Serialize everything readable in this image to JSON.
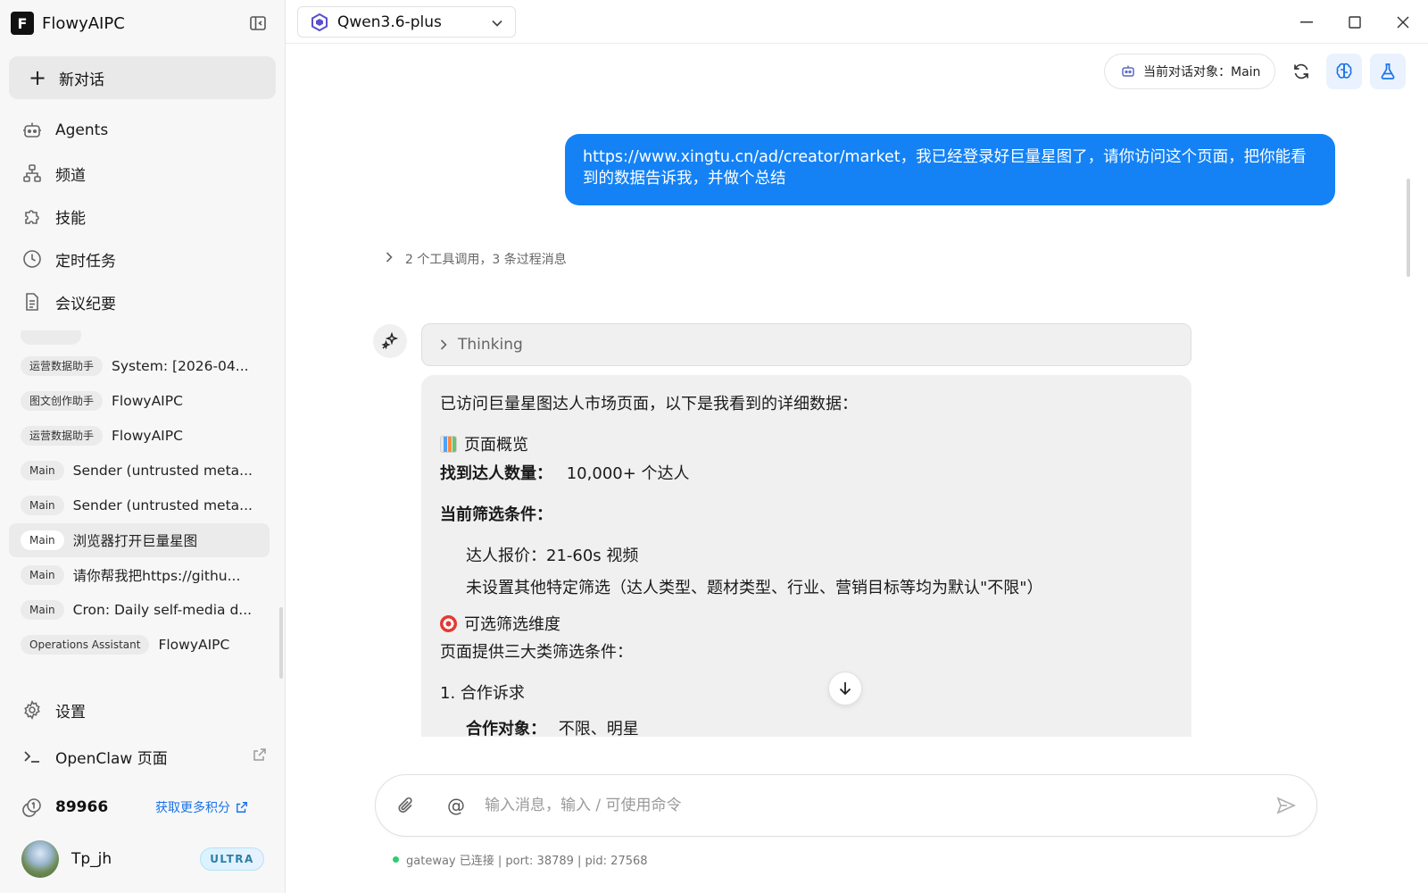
{
  "app": {
    "name": "FlowyAIPC",
    "logo_letter": "F"
  },
  "sidebar": {
    "new_chat": "新对话",
    "nav": [
      {
        "label": "Agents",
        "icon": "robot-icon"
      },
      {
        "label": "频道",
        "icon": "channel-tree-icon"
      },
      {
        "label": "技能",
        "icon": "puzzle-icon"
      },
      {
        "label": "定时任务",
        "icon": "clock-icon"
      },
      {
        "label": "会议纪要",
        "icon": "document-icon"
      }
    ],
    "sessions": [
      {
        "tag": "运营数据助手",
        "title": "System: [2026-04..."
      },
      {
        "tag": "图文创作助手",
        "title": "FlowyAIPC"
      },
      {
        "tag": "运营数据助手",
        "title": "FlowyAIPC"
      },
      {
        "tag": "Main",
        "title": "Sender (untrusted meta..."
      },
      {
        "tag": "Main",
        "title": "Sender (untrusted meta..."
      },
      {
        "tag": "Main",
        "title": "浏览器打开巨量星图",
        "active": true
      },
      {
        "tag": "Main",
        "title": "请你帮我把https://githu..."
      },
      {
        "tag": "Main",
        "title": "Cron: Daily self-media d..."
      },
      {
        "tag": "Operations Assistant",
        "title": "FlowyAIPC"
      }
    ],
    "settings": "设置",
    "openclaw": "OpenClaw 页面",
    "points": "89966",
    "more_points": "获取更多积分",
    "user": {
      "name": "Tp_jh",
      "badge": "ULTRA"
    }
  },
  "topbar": {
    "model": "Qwen3.6-plus",
    "target_label": "当前对话对象：Main"
  },
  "chat": {
    "user_message": "https://www.xingtu.cn/ad/creator/market，我已经登录好巨量星图了，请你访问这个页面，把你能看到的数据告诉我，并做个总结",
    "tool_summary": "2 个工具调用，3 条过程消息",
    "thinking_label": "Thinking",
    "reply": {
      "intro": "已访问巨量星图达人市场页面，以下是我看到的详细数据：",
      "h_overview": "页面概览",
      "count_label": "找到达人数量：",
      "count_value": "10,000+ 个达人",
      "filter_label": "当前筛选条件：",
      "filter_1": "达人报价：21-60s 视频",
      "filter_2": "未设置其他特定筛选（达人类型、题材类型、行业、营销目标等均为默认\"不限\"）",
      "h_dimensions": "可选筛选维度",
      "dim_intro": "页面提供三大类筛选条件：",
      "item_1": "1. 合作诉求",
      "partial_label": "合作对象：",
      "partial_value": "不限、明星"
    }
  },
  "composer": {
    "placeholder": "输入消息，输入 / 可使用命令",
    "at_symbol": "@",
    "status": "gateway 已连接 | port: 38789 | pid: 27568"
  }
}
